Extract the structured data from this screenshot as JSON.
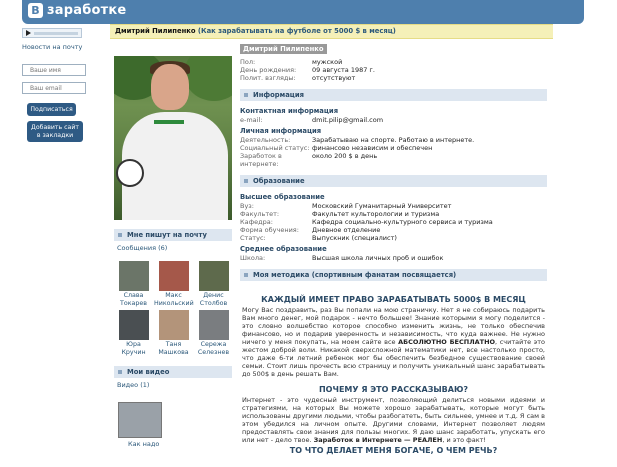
{
  "logo": {
    "mark": "В",
    "text": "заработке"
  },
  "left": {
    "news_link": "Новости на почту",
    "name_placeholder": "Ваше имя",
    "email_placeholder": "Ваш email",
    "subscribe": "Подписаться",
    "bookmark_line1": "Добавить сайт",
    "bookmark_line2": "в закладки"
  },
  "titlebar": {
    "name": "Дмитрий Пилипенко",
    "status": "(Как зарабатывать на футболе от 5000 $ в месяц)"
  },
  "profile": {
    "full_name": "Дмитрий Пилипенко",
    "basic": [
      {
        "k": "Пол:",
        "v": "мужской"
      },
      {
        "k": "День рождения:",
        "v": "09 августа 1987 г."
      },
      {
        "k": "Полит. взгляды:",
        "v": "отсутствуют"
      }
    ],
    "info_section": "Информация",
    "contact_head": "Контактная информация",
    "email_k": "e-mail:",
    "email_v": "dmit.pilip@gmail.com",
    "personal_head": "Личная информация",
    "activity_k": "Деятельность:",
    "activity_v": "Зарабатываю на спорте. Работаю в интернете.",
    "social_k": "Социальный статус:",
    "social_v": "финансово независим и обеспечен",
    "earn_k1": "Заработок в",
    "earn_k2": "интернете:",
    "earn_v": "около 200 $ в день",
    "edu_section": "Образование",
    "higher_head": "Высшее образование",
    "higher": [
      {
        "k": "Вуз:",
        "v": "Московский Гуманитарный Университет"
      },
      {
        "k": "Факультет:",
        "v": "Факультет культорологии и туризма"
      },
      {
        "k": "Кафедра:",
        "v": "Кафедра социально-культурного сервиса и туризма"
      },
      {
        "k": "Форма обучения:",
        "v": "Дневное отделение"
      },
      {
        "k": "Статус:",
        "v": "Выпускник (специалист)"
      }
    ],
    "secondary_head": "Среднее образование",
    "school_k": "Школа:",
    "school_v": "Высшая школа личных проб и ошибок",
    "method_section": "Моя методика (спортивным фанатам посвящается)"
  },
  "method": {
    "h1": "КАЖДЫЙ ИМЕЕТ ПРАВО ЗАРАБАТЫВАТЬ 5000$ В МЕСЯЦ",
    "p1a": "Могу Вас поздравить, раз Вы попали на мою страничку. Нет я не собираюсь подарить Вам много денег, мой подарок - нечто большее! Знание которыми я могу поделится - это словно волшебство которое способно изменить жизнь, не только обеспечив финансово, но и подарив уверенность и независимость, что куда важнее. Не нужно ничего у меня покупать, на моем сайте все ",
    "p1b": "АБСОЛЮТНО БЕСПЛАТНО",
    "p1c": ", считайте это жестом доброй воли. Никакой сверхсложной математики нет, все настолько просто, что даже 6-ти летний ребенок мог бы обеспечить безбедное существование своей семьи. Стоит лишь прочесть всю страницу и получить уникальный шанс зарабатывать до 500$ в день решать Вам.",
    "h2": "ПОЧЕМУ Я ЭТО РАССКАЗЫВАЮ?",
    "p2a": "Интернет - это чудесный инструмент, позволяющий делиться новыми идеями и стратегиями, на которых Вы можете хорошо зарабатывать, которые могут быть использованы другими людьми, чтобы разбогатеть, быть сильнее, умнее и т.д. Я сам в этом убедился на личном опыте. Другими словами, Интернет позволяет людям предоставлять свои знания для пользы многих. Я даю шанс заработать, упускать его или нет - дело твое. ",
    "p2b": "Заработок в Интернете — РЕАЛЕН",
    "p2c": ", и это факт!",
    "h3": "ТО ЧТО ДЕЛАЕТ МЕНЯ БОГАЧЕ, О ЧЕМ РЕЧЬ?"
  },
  "side": {
    "friends_head": "Мне пишут на почту",
    "friends_count": "Сообщения (6)",
    "friends": [
      {
        "first": "Слава",
        "last": "Токарев"
      },
      {
        "first": "Макс",
        "last": "Никольский"
      },
      {
        "first": "Денис",
        "last": "Столбов"
      },
      {
        "first": "Юра",
        "last": "Кручин"
      },
      {
        "first": "Таня",
        "last": "Машкова"
      },
      {
        "first": "Сережа",
        "last": "Селезнев"
      }
    ],
    "video_head": "Мои видео",
    "video_count": "Видео (1)",
    "video_caption": "Как надо"
  },
  "colors": {
    "header": "#4e7fad",
    "section_bg": "#dde6f0",
    "titlebar_bg": "#f5f0b8",
    "link": "#2b587a",
    "highlight": "#d02020"
  }
}
